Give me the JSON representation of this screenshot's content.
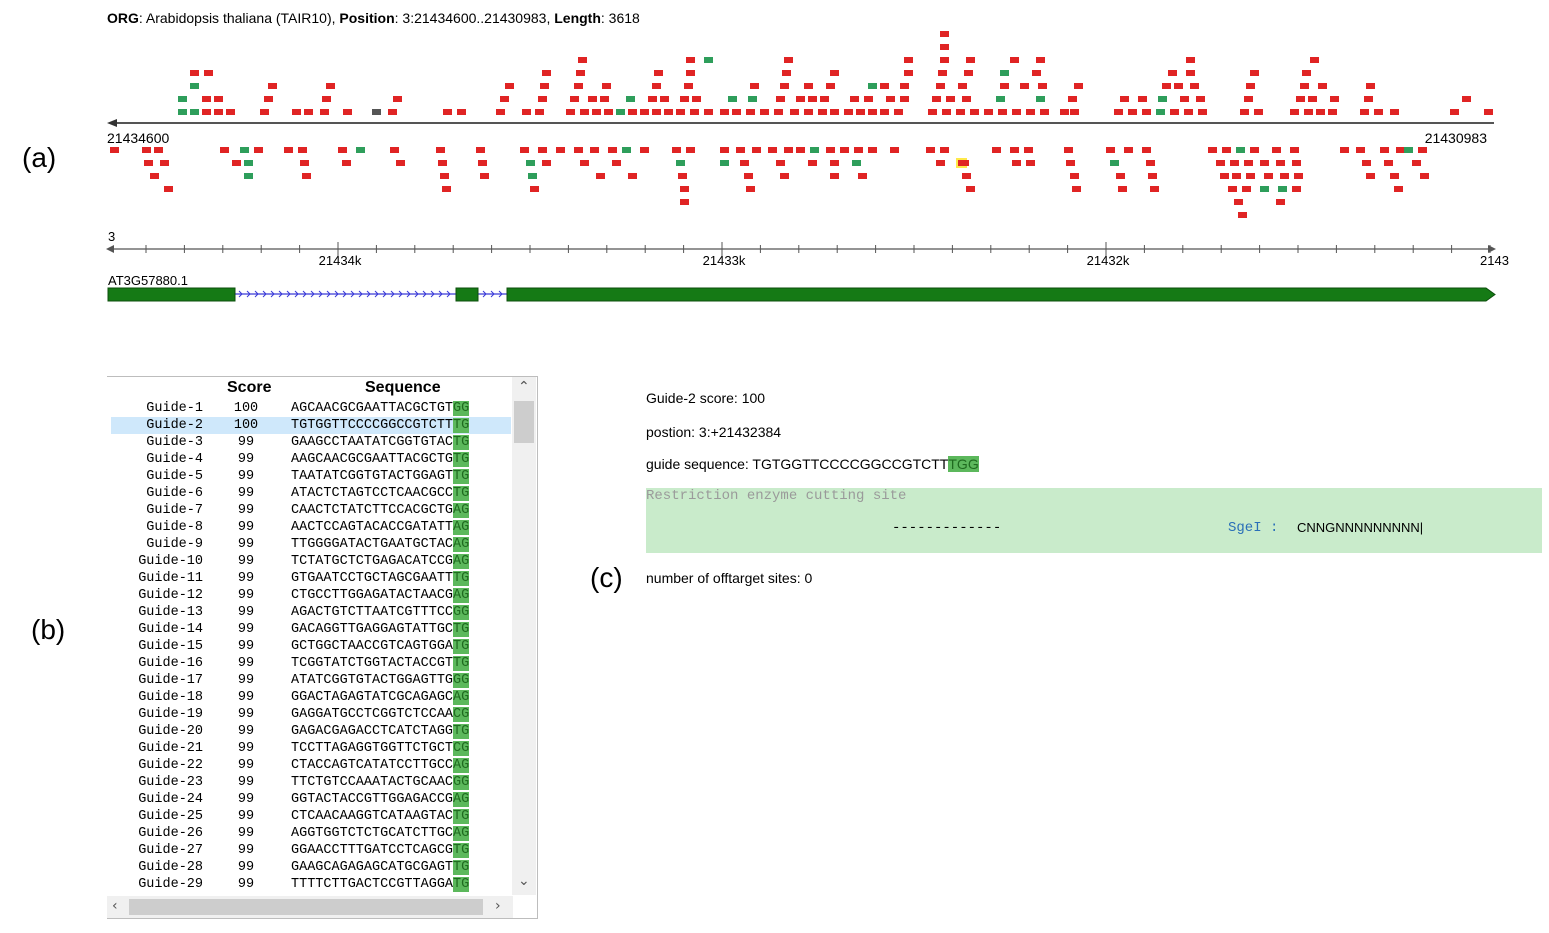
{
  "panel_labels": {
    "a": "(a)",
    "b": "(b)",
    "c": "(c)"
  },
  "header": {
    "org_label": "ORG",
    "org_value": ": Arabidopsis thaliana (TAIR10), ",
    "position_label": "Position",
    "position_value": ": 3:21434600..21430983, ",
    "length_label": "Length",
    "length_value": ": 3618"
  },
  "track": {
    "start_label": "21434600",
    "end_label": "21430983",
    "chrom_label": "3",
    "ruler_ticks": [
      "21434k",
      "21433k",
      "21432k",
      "2143"
    ],
    "gene_label": "AT3G57880.1"
  },
  "colors": {
    "red_site": "#e02424",
    "green_site": "#2e9e5b",
    "gray_site": "#555555",
    "exon": "#157a15",
    "intron": "#3a3ad8",
    "selected_row": "#cfe8fb",
    "pam_bg": "#5cb85c",
    "re_box": "#c9ebcb"
  },
  "table": {
    "headers": {
      "score": "Score",
      "sequence": "Sequence"
    },
    "rows": [
      {
        "name": "Guide-1",
        "score": "100",
        "seq": "AGCAACGCGAATTACGCTGT",
        "pam": "GG"
      },
      {
        "name": "Guide-2",
        "score": "100",
        "seq": "TGTGGTTCCCCGGCCGTCTT",
        "pam": "TG"
      },
      {
        "name": "Guide-3",
        "score": "99",
        "seq": "GAAGCCTAATATCGGTGTAC",
        "pam": "TG"
      },
      {
        "name": "Guide-4",
        "score": "99",
        "seq": "AAGCAACGCGAATTACGCTG",
        "pam": "TG"
      },
      {
        "name": "Guide-5",
        "score": "99",
        "seq": "TAATATCGGTGTACTGGAGT",
        "pam": "TG"
      },
      {
        "name": "Guide-6",
        "score": "99",
        "seq": "ATACTCTAGTCCTCAACGCC",
        "pam": "TG"
      },
      {
        "name": "Guide-7",
        "score": "99",
        "seq": "CAACTCTATCTTCCACGCTG",
        "pam": "AG"
      },
      {
        "name": "Guide-8",
        "score": "99",
        "seq": "AACTCCAGTACACCGATATT",
        "pam": "AG"
      },
      {
        "name": "Guide-9",
        "score": "99",
        "seq": "TTGGGGATACTGAATGCTAC",
        "pam": "AG"
      },
      {
        "name": "Guide-10",
        "score": "99",
        "seq": "TCTATGCTCTGAGACATCCG",
        "pam": "AG"
      },
      {
        "name": "Guide-11",
        "score": "99",
        "seq": "GTGAATCCTGCTAGCGAATT",
        "pam": "TG"
      },
      {
        "name": "Guide-12",
        "score": "99",
        "seq": "CTGCCTTGGAGATACTAACG",
        "pam": "AG"
      },
      {
        "name": "Guide-13",
        "score": "99",
        "seq": "AGACTGTCTTAATCGTTTCC",
        "pam": "GG"
      },
      {
        "name": "Guide-14",
        "score": "99",
        "seq": "GACAGGTTGAGGAGTATTGC",
        "pam": "TG"
      },
      {
        "name": "Guide-15",
        "score": "99",
        "seq": "GCTGGCTAACCGTCAGTGGA",
        "pam": "TG"
      },
      {
        "name": "Guide-16",
        "score": "99",
        "seq": "TCGGTATCTGGTACTACCGT",
        "pam": "TG"
      },
      {
        "name": "Guide-17",
        "score": "99",
        "seq": "ATATCGGTGTACTGGAGTTG",
        "pam": "GG"
      },
      {
        "name": "Guide-18",
        "score": "99",
        "seq": "GGACTAGAGTATCGCAGAGC",
        "pam": "AG"
      },
      {
        "name": "Guide-19",
        "score": "99",
        "seq": "GAGGATGCCTCGGTCTCCAA",
        "pam": "CG"
      },
      {
        "name": "Guide-20",
        "score": "99",
        "seq": "GAGACGAGACCTCATCTAGG",
        "pam": "TG"
      },
      {
        "name": "Guide-21",
        "score": "99",
        "seq": "TCCTTAGAGGTGGTTCTGCT",
        "pam": "CG"
      },
      {
        "name": "Guide-22",
        "score": "99",
        "seq": "CTACCAGTCATATCCTTGCC",
        "pam": "AG"
      },
      {
        "name": "Guide-23",
        "score": "99",
        "seq": "TTCTGTCCAAATACTGCAAC",
        "pam": "GG"
      },
      {
        "name": "Guide-24",
        "score": "99",
        "seq": "GGTACTACCGTTGGAGACCG",
        "pam": "AG"
      },
      {
        "name": "Guide-25",
        "score": "99",
        "seq": "CTCAACAAGGTCATAAGTAC",
        "pam": "TG"
      },
      {
        "name": "Guide-26",
        "score": "99",
        "seq": "AGGTGGTCTCTGCATCTTGC",
        "pam": "AG"
      },
      {
        "name": "Guide-27",
        "score": "99",
        "seq": "GGAACCTTTGATCCTCAGCG",
        "pam": "TG"
      },
      {
        "name": "Guide-28",
        "score": "99",
        "seq": "GAAGCAGAGAGCATGCGAGT",
        "pam": "TG"
      },
      {
        "name": "Guide-29",
        "score": "99",
        "seq": "TTTTCTTGACTCCGTTAGGA",
        "pam": "TG"
      }
    ]
  },
  "detail": {
    "score_line": "Guide-2 score: 100",
    "position_line": "postion: 3:+21432384",
    "seq_label": "guide sequence: ",
    "seq_value": "TGTGGTTCCCCGGCCGTCTT",
    "seq_pam": "TGG",
    "re_title": "Restriction enzyme cutting site",
    "re_dashes": "-------------",
    "re_enzyme": "SgeI :",
    "re_site": "CNNGNNNNNNNNN|",
    "offtarget_line": "number of offtarget sites: 0"
  }
}
